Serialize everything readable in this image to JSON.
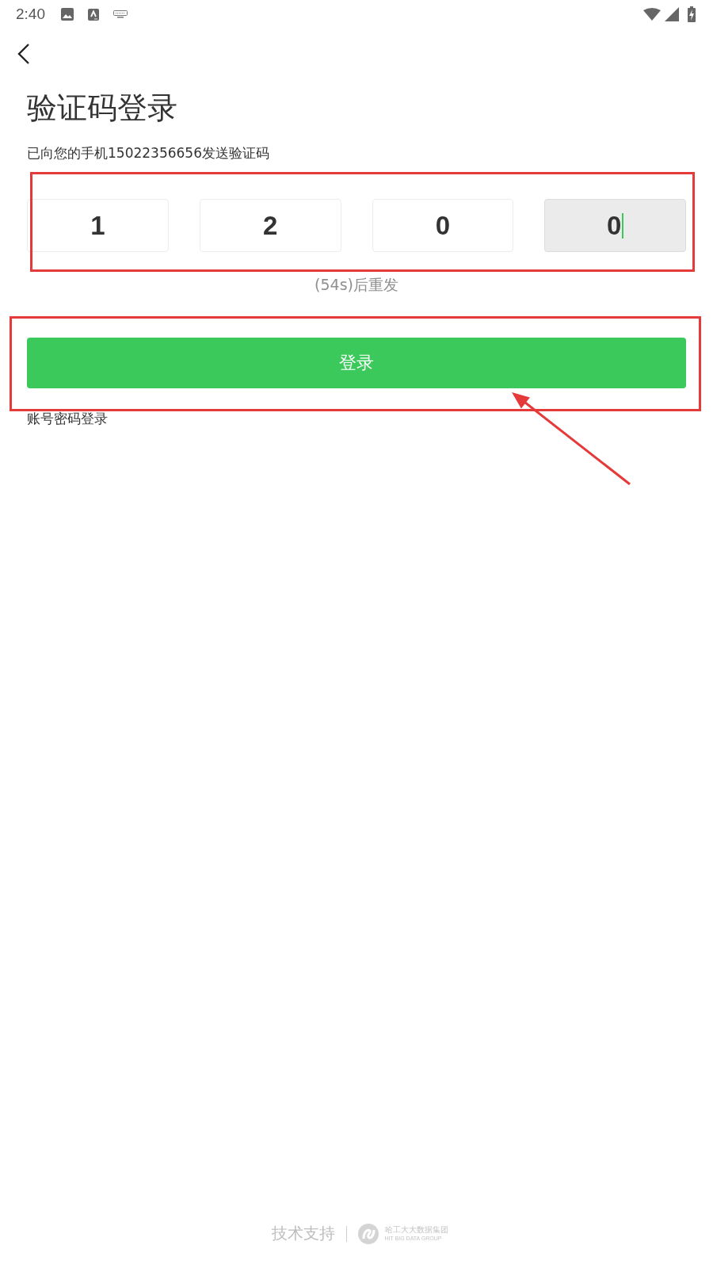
{
  "status_bar": {
    "time": "2:40"
  },
  "title": "验证码登录",
  "subtitle": "已向您的手机15022356656发送验证码",
  "code_input": {
    "highlighted": true,
    "boxes": [
      {
        "digit": "1",
        "selected": false
      },
      {
        "digit": "2",
        "selected": false
      },
      {
        "digit": "0",
        "selected": false
      },
      {
        "digit": "0",
        "selected": true
      }
    ]
  },
  "resend": {
    "label": "(54s)后重发",
    "disabled": true
  },
  "login_button": {
    "label": "登录",
    "highlighted": true,
    "arrow": true
  },
  "alt_login": "账号密码登录",
  "footer": {
    "label": "技术支持",
    "logo_name": "哈工大大数据集团",
    "logo_subtitle": "HIT BIG DATA GROUP"
  }
}
